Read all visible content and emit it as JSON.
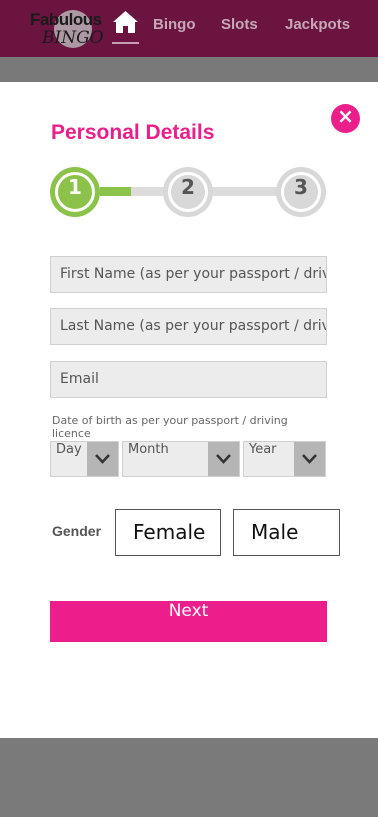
{
  "header": {
    "logo_word1": "Fabulous",
    "logo_word2": "BINGO",
    "nav": [
      {
        "label": "Bingo"
      },
      {
        "label": "Slots"
      },
      {
        "label": "Jackpots"
      }
    ],
    "colors": {
      "bar": "#6b1440",
      "nav_text": "#c6a8b7"
    }
  },
  "modal": {
    "title": "Personal Details",
    "close_icon": "close-icon",
    "steps": [
      {
        "number": "1",
        "active": true
      },
      {
        "number": "2",
        "active": false
      },
      {
        "number": "3",
        "active": false
      }
    ],
    "progress_fraction": 0.35,
    "fields": {
      "first_name_placeholder": "First Name (as per your passport / driving licence)",
      "last_name_placeholder": "Last Name (as per your passport / driving licence)",
      "email_placeholder": "Email"
    },
    "dob": {
      "label": "Date of birth as per your passport / driving licence",
      "day": "Day",
      "month": "Month",
      "year": "Year"
    },
    "gender": {
      "label": "Gender",
      "options": [
        "Female",
        "Male"
      ]
    },
    "next_label": "Next",
    "colors": {
      "accent": "#ec1e8c",
      "step_active": "#8bc34a",
      "step_inactive": "#d8d8d8"
    }
  }
}
